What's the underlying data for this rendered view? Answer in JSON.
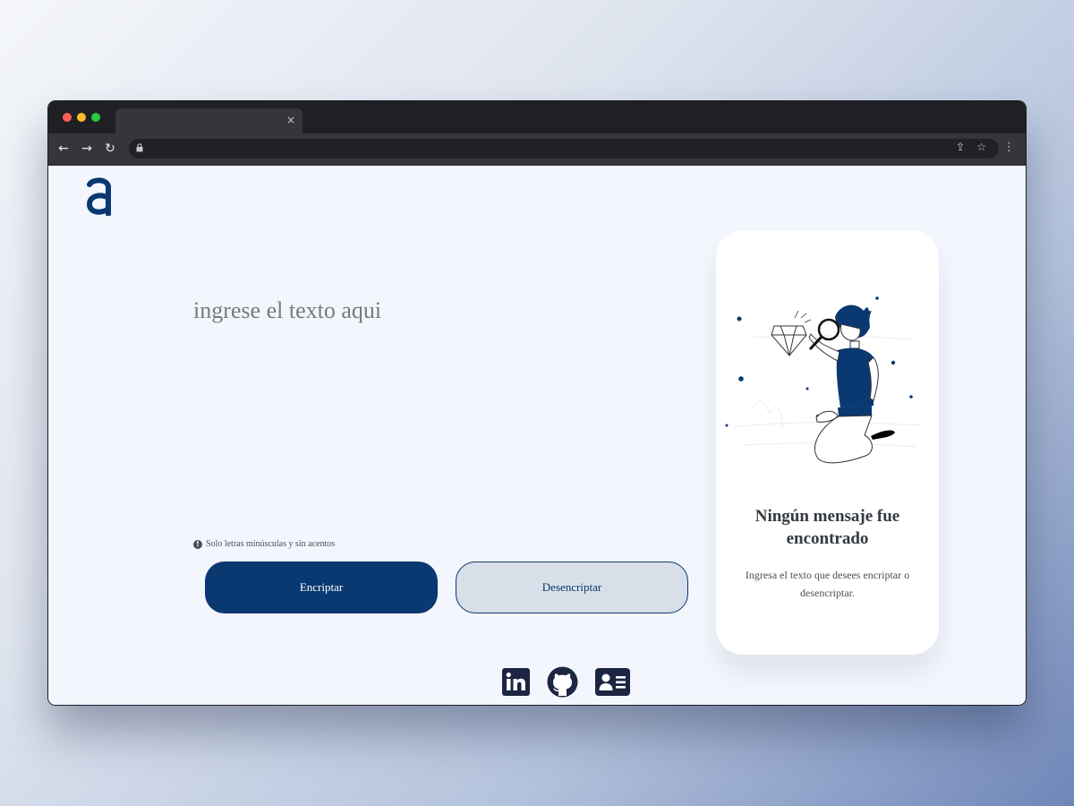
{
  "browser": {
    "tab_close_glyph": "×",
    "back_glyph": "←",
    "forward_glyph": "→",
    "reload_glyph": "↻",
    "share_glyph": "⇪",
    "star_glyph": "☆",
    "menu_glyph": "⋮"
  },
  "editor": {
    "placeholder": "ingrese el texto aqui",
    "value": ""
  },
  "hint": {
    "icon": "!",
    "text": "Solo letras minúsculas y sin acentos"
  },
  "buttons": {
    "encrypt_label": "Encriptar",
    "decrypt_label": "Desencriptar"
  },
  "result_card": {
    "title": "Ningún mensaje fue encontrado",
    "text": "Ingresa el texto que desees encriptar o desencriptar."
  },
  "social": [
    "linkedin-icon",
    "github-icon",
    "contact-card-icon"
  ],
  "colors": {
    "primary": "#0a3871",
    "page_bg": "#f3f6fd",
    "secondary_btn_bg": "#d8dfe8"
  }
}
